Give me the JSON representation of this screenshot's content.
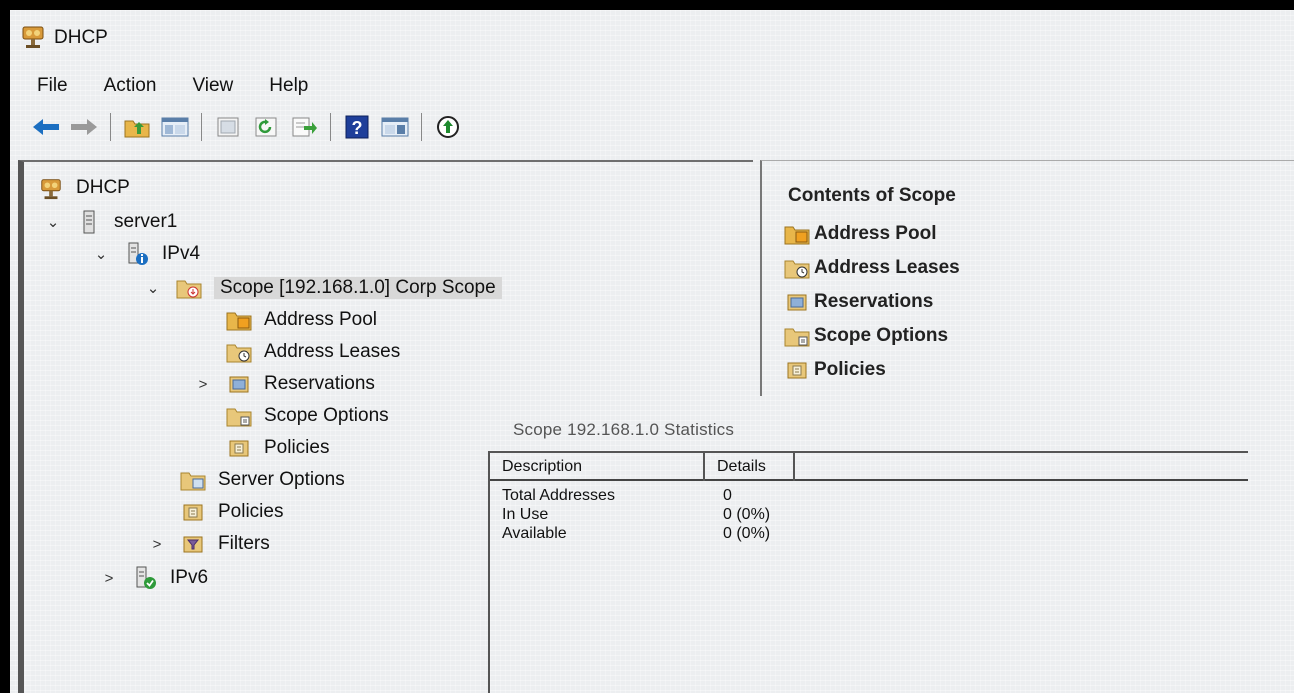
{
  "window": {
    "title": "DHCP"
  },
  "menu": {
    "file": "File",
    "action": "Action",
    "view": "View",
    "help": "Help"
  },
  "toolbar": {
    "buttons": [
      "back-icon",
      "forward-icon",
      "up-folder-icon",
      "show-hide-tree-icon",
      "properties-icon",
      "refresh-icon",
      "export-list-icon",
      "help-icon",
      "show-action-pane-icon",
      "activate-icon"
    ]
  },
  "tree": {
    "root": "DHCP",
    "server": "server1",
    "ipv4": "IPv4",
    "scope": "Scope [192.168.1.0] Corp Scope",
    "address_pool": "Address Pool",
    "address_leases": "Address Leases",
    "reservations": "Reservations",
    "scope_options": "Scope Options",
    "scope_policies": "Policies",
    "server_options": "Server Options",
    "policies": "Policies",
    "filters": "Filters",
    "ipv6": "IPv6"
  },
  "contents": {
    "title": "Contents of Scope",
    "items": [
      "Address Pool",
      "Address Leases",
      "Reservations",
      "Scope Options",
      "Policies"
    ]
  },
  "stats": {
    "title": "Scope 192.168.1.0 Statistics",
    "headers": {
      "description": "Description",
      "details": "Details"
    },
    "rows": [
      {
        "label": "Total Addresses",
        "value": "0"
      },
      {
        "label": "In Use",
        "value": "0 (0%)"
      },
      {
        "label": "Available",
        "value": "0 (0%)"
      }
    ]
  },
  "colors": {
    "accent_blue": "#1c6fc1",
    "folder": "#e8b64a",
    "background": "#eceef0"
  }
}
